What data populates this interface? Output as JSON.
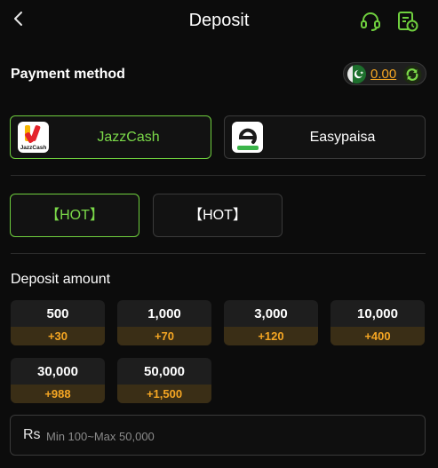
{
  "header": {
    "title": "Deposit",
    "back_icon": "chevron-left-icon",
    "support_icon": "headset-icon",
    "history_icon": "records-clock-icon"
  },
  "payment": {
    "label": "Payment method",
    "balance": "0.00",
    "methods": [
      {
        "name": "JazzCash",
        "logo_text": "JazzCash",
        "selected": true
      },
      {
        "name": "Easypaisa",
        "selected": false
      }
    ]
  },
  "channels": [
    {
      "label": "【HOT】",
      "selected": true
    },
    {
      "label": "【HOT】",
      "selected": false
    }
  ],
  "deposit": {
    "label": "Deposit amount",
    "amounts": [
      {
        "value": "500",
        "bonus": "+30"
      },
      {
        "value": "1,000",
        "bonus": "+70"
      },
      {
        "value": "3,000",
        "bonus": "+120"
      },
      {
        "value": "10,000",
        "bonus": "+400"
      },
      {
        "value": "30,000",
        "bonus": "+988"
      },
      {
        "value": "50,000",
        "bonus": "+1,500"
      }
    ],
    "currency": "Rs",
    "placeholder": "Min 100~Max 50,000"
  },
  "colors": {
    "background": "#0c0c0c",
    "accent_green": "#6fcf3e",
    "bonus_orange": "#f5a623"
  }
}
